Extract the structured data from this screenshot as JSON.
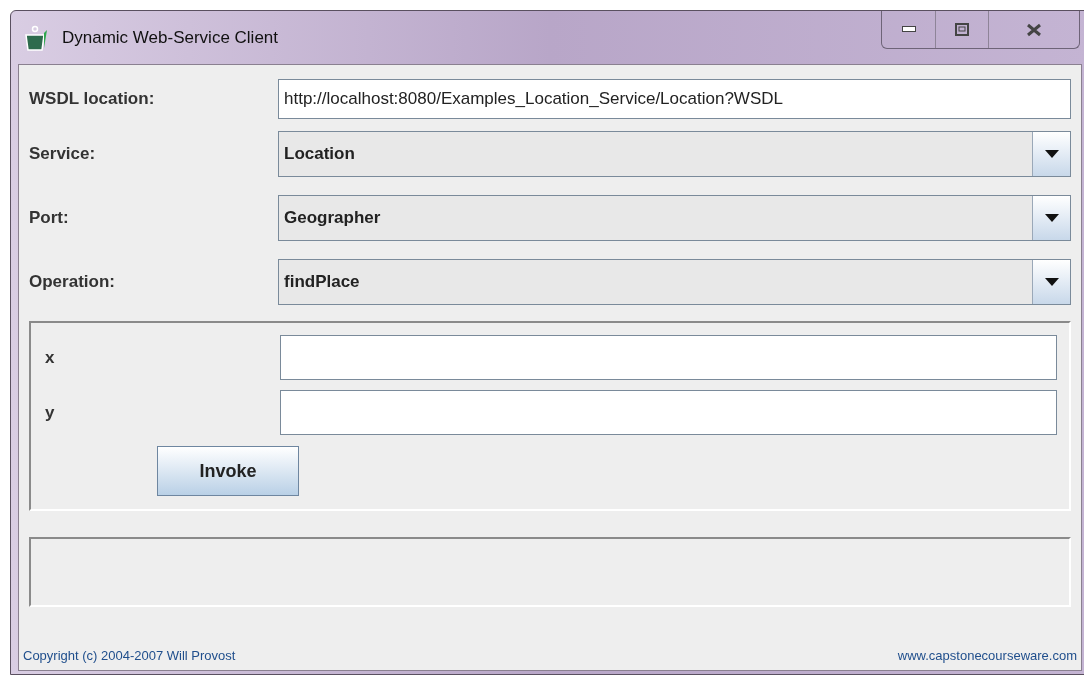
{
  "window": {
    "title": "Dynamic Web-Service Client"
  },
  "wsdl": {
    "label": "WSDL location:",
    "value": "http://localhost:8080/Examples_Location_Service/Location?WSDL"
  },
  "selectors": [
    {
      "label": "Service:",
      "value": "Location"
    },
    {
      "label": "Port:",
      "value": "Geographer"
    },
    {
      "label": "Operation:",
      "value": "findPlace"
    }
  ],
  "parameters": [
    {
      "label": "x"
    },
    {
      "label": "y"
    }
  ],
  "invoke_button": "Invoke",
  "footer": {
    "copyright": "Copyright (c) 2004-2007 Will Provost",
    "website": "www.capstonecourseware.com"
  }
}
